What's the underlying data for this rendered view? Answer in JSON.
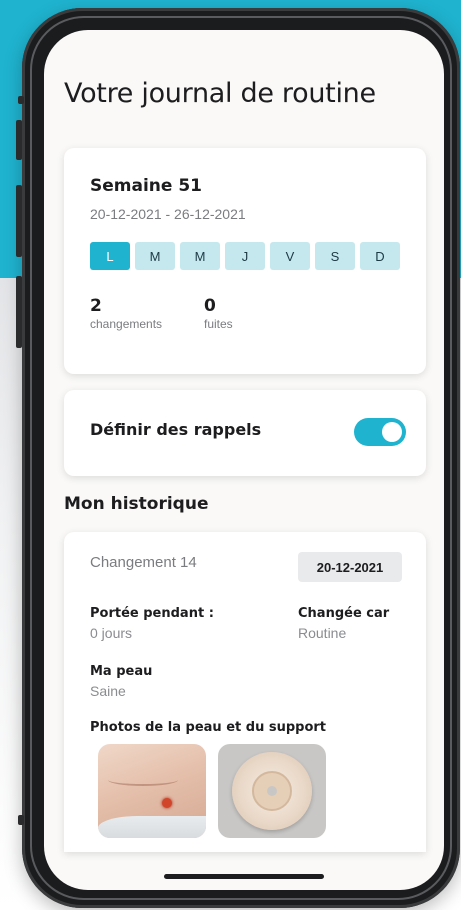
{
  "header": {
    "title": "Votre journal de routine"
  },
  "week": {
    "title": "Semaine 51",
    "range": "20-12-2021 - 26-12-2021",
    "days": [
      "L",
      "M",
      "M",
      "J",
      "V",
      "S",
      "D"
    ],
    "active_day": "L",
    "stats": [
      {
        "value": "2",
        "label": "changements"
      },
      {
        "value": "0",
        "label": "fuites"
      }
    ]
  },
  "reminders": {
    "label": "Définir des rappels",
    "enabled": true
  },
  "history": {
    "title": "Mon historique",
    "entry": {
      "title": "Changement 14",
      "date": "20-12-2021",
      "worn_label": "Portée pendant :",
      "worn_value": "0 jours",
      "reason_label": "Changée car",
      "reason_value": "Routine",
      "skin_label": "Ma peau",
      "skin_value": "Saine",
      "photos_label": "Photos de la peau et du support"
    }
  },
  "colors": {
    "accent": "#1fb3cf",
    "day_inactive": "#c5e8ef",
    "background": "#faf9f7"
  }
}
